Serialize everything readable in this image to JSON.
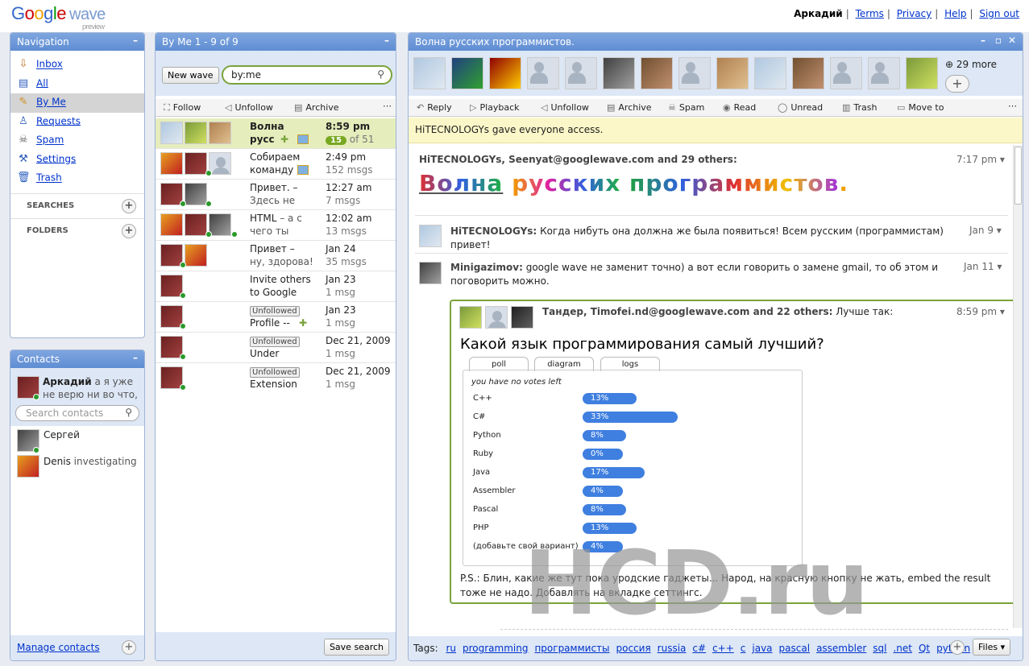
{
  "app": {
    "logo_google": "Google",
    "logo_wave": "wave",
    "logo_preview": "preview"
  },
  "toplinks": {
    "user": "Аркадий",
    "terms": "Terms",
    "privacy": "Privacy",
    "help": "Help",
    "signout": "Sign out"
  },
  "navigation": {
    "title": "Navigation",
    "items": [
      {
        "label": "Inbox",
        "icon": "inbox-icon"
      },
      {
        "label": "All",
        "icon": "all-icon"
      },
      {
        "label": "By Me",
        "icon": "pencil-icon"
      },
      {
        "label": "Requests",
        "icon": "person-icon"
      },
      {
        "label": "Spam",
        "icon": "spam-icon"
      },
      {
        "label": "Settings",
        "icon": "wrench-icon"
      },
      {
        "label": "Trash",
        "icon": "trash-icon"
      }
    ],
    "searches": "SEARCHES",
    "folders": "FOLDERS"
  },
  "contacts": {
    "title": "Contacts",
    "me_name": "Аркадий",
    "me_status": "а я уже не верю ни во что, меня",
    "search_placeholder": "Search contacts",
    "list": [
      {
        "name": "Сергей",
        "status": ""
      },
      {
        "name": "Denis",
        "status": "investigating"
      }
    ],
    "manage": "Manage contacts"
  },
  "search_panel": {
    "title": "By Me 1 - 9 of 9",
    "new_wave": "New wave",
    "query": "by:me",
    "toolbar": {
      "follow": "Follow",
      "unfollow": "Unfollow",
      "archive": "Archive"
    },
    "save_search": "Save search",
    "rows": [
      {
        "t1": "Волна",
        "t2": "русс",
        "d1": "8:59 pm",
        "badge": "15",
        "d2": "of 51"
      },
      {
        "t1": "Собираем",
        "t2": "команду",
        "d1": "2:49 pm",
        "d2": "152 msgs"
      },
      {
        "t1": "Привет. –",
        "t2": "Здесь не",
        "d1": "12:27 am",
        "d2": "7 msgs"
      },
      {
        "t1": "HTML",
        "t1b": "– а с",
        "t2": "чего ты",
        "d1": "12:02 am",
        "d2": "13 msgs"
      },
      {
        "t1": "Привет –",
        "t2": "ну, здорова!",
        "d1": "Jan 24",
        "d2": "35 msgs"
      },
      {
        "t1": "Invite others",
        "t2": "to Google",
        "d1": "Jan 23",
        "d2": "1 msg"
      },
      {
        "unf": "Unfollowed",
        "t2": "Profile --",
        "d1": "Jan 23",
        "d2": "1 msg"
      },
      {
        "unf": "Unfollowed",
        "t2": "Under",
        "d1": "Dec 21, 2009",
        "d2": "1 msg"
      },
      {
        "unf": "Unfollowed",
        "t2": "Extension",
        "d1": "Dec 21, 2009",
        "d2": "1 msg"
      }
    ]
  },
  "wave": {
    "title": "Волна русских программистов.",
    "more": "29 more",
    "toolbar": {
      "reply": "Reply",
      "playback": "Playback",
      "unfollow": "Unfollow",
      "archive": "Archive",
      "spam": "Spam",
      "read": "Read",
      "unread": "Unread",
      "trash": "Trash",
      "moveto": "Move to"
    },
    "notice": "HiTECNOLOGYs gave everyone access.",
    "root_authors": "HiTECNOLOGYs, Seenyat@googlewave.com and 29 others:",
    "root_time": "7:17 pm",
    "big_title_parts": [
      "Волна",
      " ",
      "русских",
      " ",
      "программистов",
      "."
    ],
    "blip1_author": "HiTECNOLOGYs:",
    "blip1_text": "Когда нибуть она должна же была появиться! Всем русским (программистам) привет!",
    "blip1_date": "Jan 9",
    "blip2_author": "Minigazimov:",
    "blip2_text": "google wave не заменит точно) а вот если говорить о замене gmail, то об этом и поговорить можно.",
    "blip2_date": "Jan 11",
    "blip3_authors": "Тандер, Timofei.nd@googlewave.com and 22 others:",
    "blip3_lead": "Лучше так:",
    "blip3_time": "8:59 pm",
    "question": "Какой язык программирования самый лучший?",
    "poll_tabs": [
      "poll",
      "diagram",
      "logs"
    ],
    "no_votes": "you have no votes left",
    "poll": [
      {
        "label": "C++",
        "pct": "13%",
        "v": 13
      },
      {
        "label": "C#",
        "pct": "33%",
        "v": 33
      },
      {
        "label": "Python",
        "pct": "8%",
        "v": 8
      },
      {
        "label": "Ruby",
        "pct": "0%",
        "v": 0
      },
      {
        "label": "Java",
        "pct": "17%",
        "v": 17
      },
      {
        "label": "Assembler",
        "pct": "4%",
        "v": 4
      },
      {
        "label": "Pascal",
        "pct": "8%",
        "v": 8
      },
      {
        "label": "PHP",
        "pct": "13%",
        "v": 13
      },
      {
        "label": "(добавьте свой вариант)",
        "pct": "4%",
        "v": 4
      }
    ],
    "ps": "P.S.: Блин, какие же тут пока уродские гаджеты... Народ, на красную кнопку не жать, embed the result тоже не надо. Добавлять на вкладке сеттингс.",
    "tags_label": "Tags:",
    "tags": [
      "ru",
      "programming",
      "программисты",
      "россия",
      "russia",
      "c#",
      "c++",
      "c",
      "java",
      "pascal",
      "assembler",
      "sql",
      ".net",
      "Qt",
      "python"
    ],
    "files": "Files"
  },
  "watermark": "HCD.ru",
  "colors": {
    "header_blue": "#6a96d8",
    "selected_row": "#e5edbc",
    "poll_bar": "#3f7fe0",
    "green_border": "#7aa33a"
  }
}
